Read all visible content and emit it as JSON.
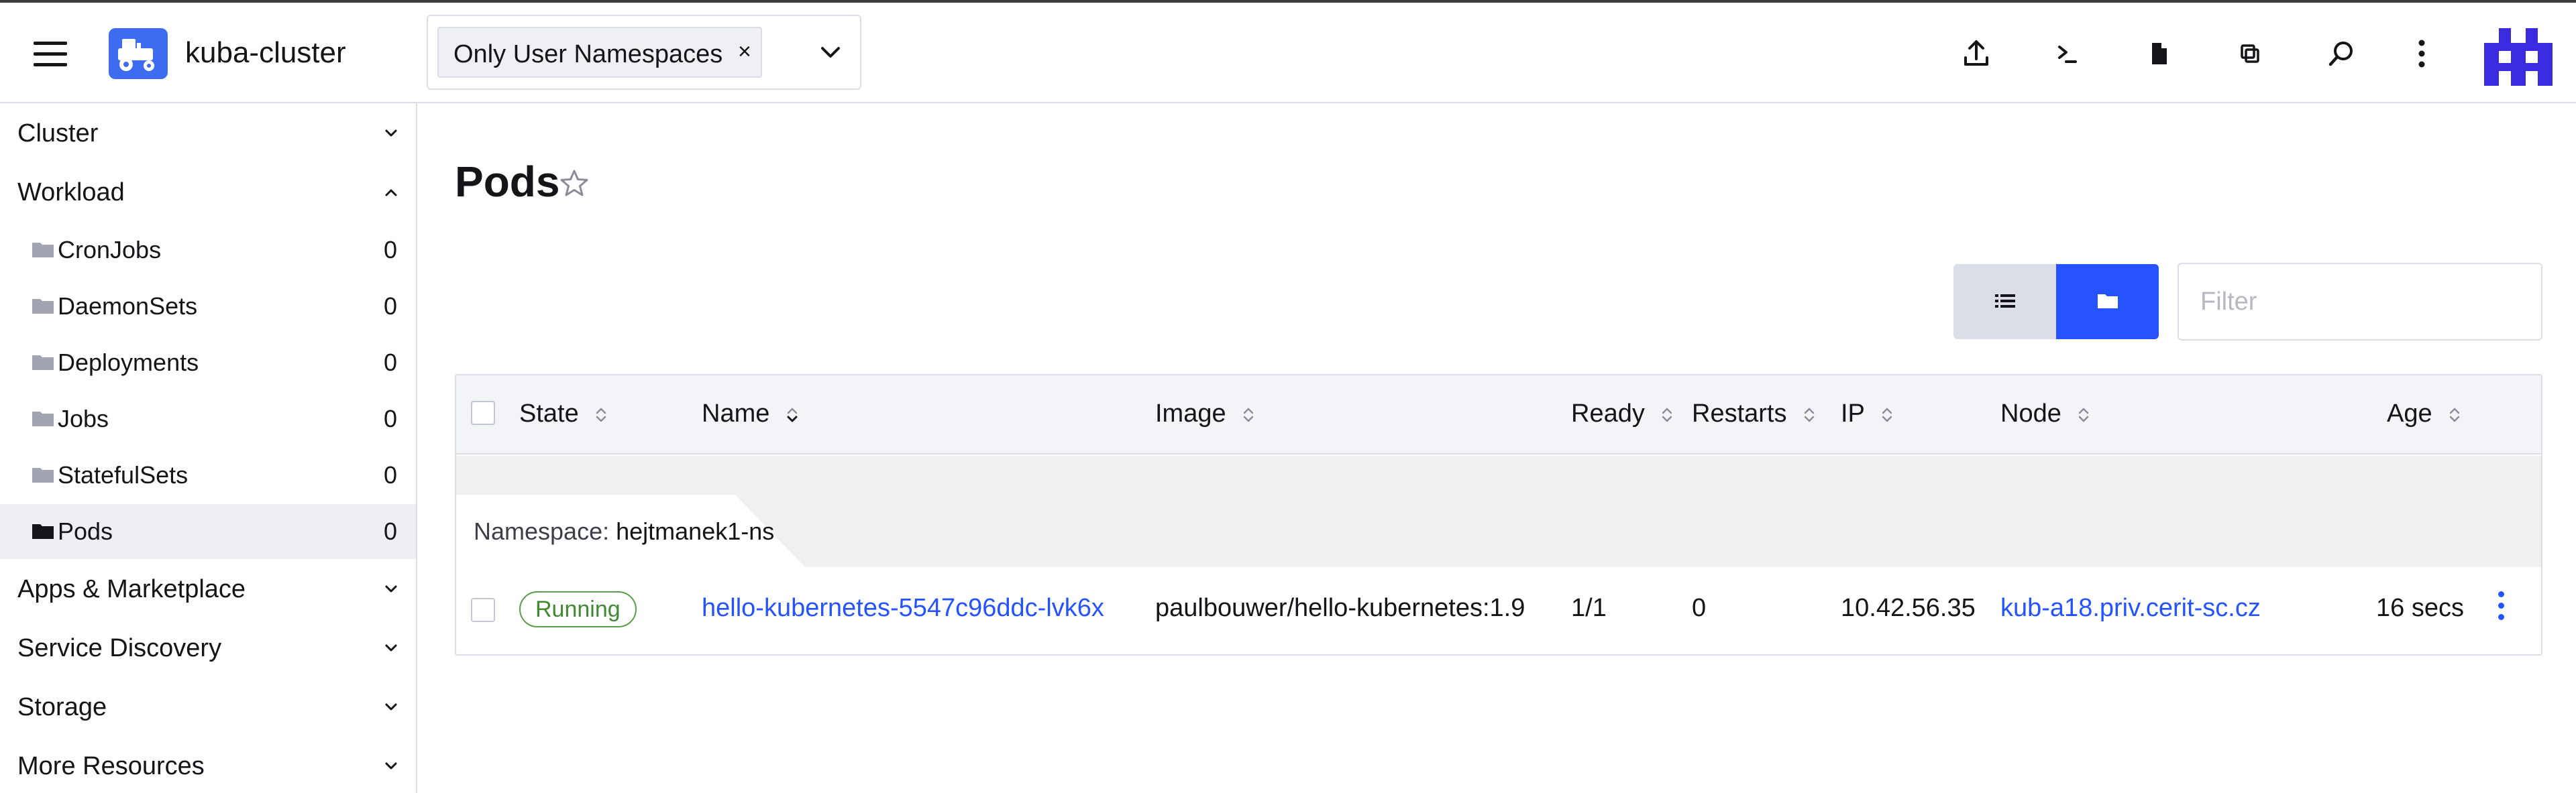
{
  "header": {
    "cluster_name": "kuba-cluster",
    "namespace_filter": {
      "chip_label": "Only User Namespaces",
      "chip_remove": "×"
    }
  },
  "sidebar": {
    "groups": [
      {
        "label": "Cluster"
      },
      {
        "label": "Workload"
      },
      {
        "label": "Apps & Marketplace"
      },
      {
        "label": "Service Discovery"
      },
      {
        "label": "Storage"
      },
      {
        "label": "More Resources"
      }
    ],
    "workload_items": [
      {
        "label": "CronJobs",
        "count": "0"
      },
      {
        "label": "DaemonSets",
        "count": "0"
      },
      {
        "label": "Deployments",
        "count": "0"
      },
      {
        "label": "Jobs",
        "count": "0"
      },
      {
        "label": "StatefulSets",
        "count": "0"
      },
      {
        "label": "Pods",
        "count": "0"
      }
    ],
    "active_item": "Pods"
  },
  "page": {
    "title": "Pods",
    "filter_placeholder": "Filter"
  },
  "table": {
    "columns": [
      "State",
      "Name",
      "Image",
      "Ready",
      "Restarts",
      "IP",
      "Node",
      "Age"
    ],
    "group": {
      "key": "Namespace:",
      "value": "hejtmanek1-ns"
    },
    "rows": [
      {
        "state": "Running",
        "name": "hello-kubernetes-5547c96ddc-lvk6x",
        "image": "paulbouwer/hello-kubernetes:1.9",
        "ready": "1/1",
        "restarts": "0",
        "ip": "10.42.56.35",
        "node": "kub-a18.priv.cerit-sc.cz",
        "age": "16 secs"
      }
    ]
  },
  "icons": {
    "top_actions": [
      "upload-icon",
      "terminal-icon",
      "file-icon",
      "copy-icon",
      "search-icon",
      "more-vertical-icon"
    ]
  },
  "colors": {
    "accent": "#2453ff",
    "running": "#3f8a30",
    "logo": "#3d6cf0",
    "avatar": "#3b2ae0"
  }
}
